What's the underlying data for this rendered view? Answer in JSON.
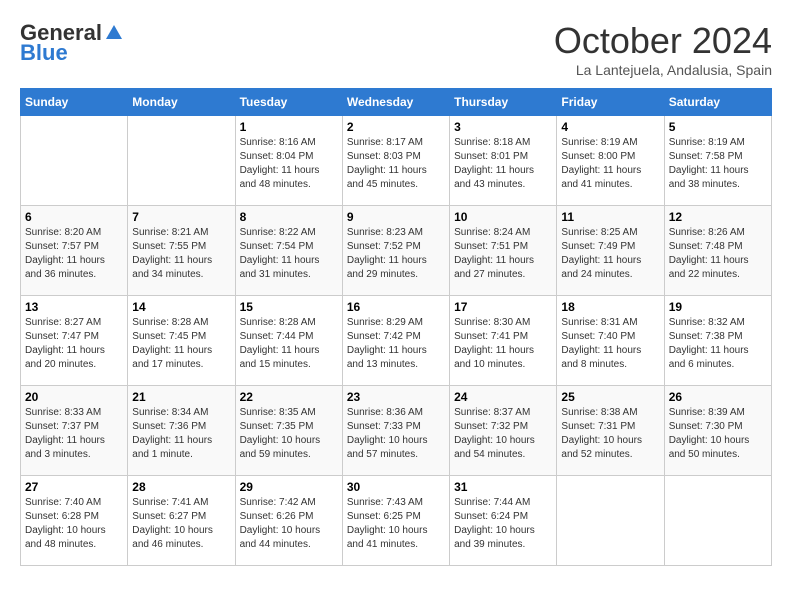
{
  "header": {
    "logo_general": "General",
    "logo_blue": "Blue",
    "month_title": "October 2024",
    "location": "La Lantejuela, Andalusia, Spain"
  },
  "weekdays": [
    "Sunday",
    "Monday",
    "Tuesday",
    "Wednesday",
    "Thursday",
    "Friday",
    "Saturday"
  ],
  "weeks": [
    [
      {
        "day": "",
        "info": ""
      },
      {
        "day": "",
        "info": ""
      },
      {
        "day": "1",
        "info": "Sunrise: 8:16 AM\nSunset: 8:04 PM\nDaylight: 11 hours and 48 minutes."
      },
      {
        "day": "2",
        "info": "Sunrise: 8:17 AM\nSunset: 8:03 PM\nDaylight: 11 hours and 45 minutes."
      },
      {
        "day": "3",
        "info": "Sunrise: 8:18 AM\nSunset: 8:01 PM\nDaylight: 11 hours and 43 minutes."
      },
      {
        "day": "4",
        "info": "Sunrise: 8:19 AM\nSunset: 8:00 PM\nDaylight: 11 hours and 41 minutes."
      },
      {
        "day": "5",
        "info": "Sunrise: 8:19 AM\nSunset: 7:58 PM\nDaylight: 11 hours and 38 minutes."
      }
    ],
    [
      {
        "day": "6",
        "info": "Sunrise: 8:20 AM\nSunset: 7:57 PM\nDaylight: 11 hours and 36 minutes."
      },
      {
        "day": "7",
        "info": "Sunrise: 8:21 AM\nSunset: 7:55 PM\nDaylight: 11 hours and 34 minutes."
      },
      {
        "day": "8",
        "info": "Sunrise: 8:22 AM\nSunset: 7:54 PM\nDaylight: 11 hours and 31 minutes."
      },
      {
        "day": "9",
        "info": "Sunrise: 8:23 AM\nSunset: 7:52 PM\nDaylight: 11 hours and 29 minutes."
      },
      {
        "day": "10",
        "info": "Sunrise: 8:24 AM\nSunset: 7:51 PM\nDaylight: 11 hours and 27 minutes."
      },
      {
        "day": "11",
        "info": "Sunrise: 8:25 AM\nSunset: 7:49 PM\nDaylight: 11 hours and 24 minutes."
      },
      {
        "day": "12",
        "info": "Sunrise: 8:26 AM\nSunset: 7:48 PM\nDaylight: 11 hours and 22 minutes."
      }
    ],
    [
      {
        "day": "13",
        "info": "Sunrise: 8:27 AM\nSunset: 7:47 PM\nDaylight: 11 hours and 20 minutes."
      },
      {
        "day": "14",
        "info": "Sunrise: 8:28 AM\nSunset: 7:45 PM\nDaylight: 11 hours and 17 minutes."
      },
      {
        "day": "15",
        "info": "Sunrise: 8:28 AM\nSunset: 7:44 PM\nDaylight: 11 hours and 15 minutes."
      },
      {
        "day": "16",
        "info": "Sunrise: 8:29 AM\nSunset: 7:42 PM\nDaylight: 11 hours and 13 minutes."
      },
      {
        "day": "17",
        "info": "Sunrise: 8:30 AM\nSunset: 7:41 PM\nDaylight: 11 hours and 10 minutes."
      },
      {
        "day": "18",
        "info": "Sunrise: 8:31 AM\nSunset: 7:40 PM\nDaylight: 11 hours and 8 minutes."
      },
      {
        "day": "19",
        "info": "Sunrise: 8:32 AM\nSunset: 7:38 PM\nDaylight: 11 hours and 6 minutes."
      }
    ],
    [
      {
        "day": "20",
        "info": "Sunrise: 8:33 AM\nSunset: 7:37 PM\nDaylight: 11 hours and 3 minutes."
      },
      {
        "day": "21",
        "info": "Sunrise: 8:34 AM\nSunset: 7:36 PM\nDaylight: 11 hours and 1 minute."
      },
      {
        "day": "22",
        "info": "Sunrise: 8:35 AM\nSunset: 7:35 PM\nDaylight: 10 hours and 59 minutes."
      },
      {
        "day": "23",
        "info": "Sunrise: 8:36 AM\nSunset: 7:33 PM\nDaylight: 10 hours and 57 minutes."
      },
      {
        "day": "24",
        "info": "Sunrise: 8:37 AM\nSunset: 7:32 PM\nDaylight: 10 hours and 54 minutes."
      },
      {
        "day": "25",
        "info": "Sunrise: 8:38 AM\nSunset: 7:31 PM\nDaylight: 10 hours and 52 minutes."
      },
      {
        "day": "26",
        "info": "Sunrise: 8:39 AM\nSunset: 7:30 PM\nDaylight: 10 hours and 50 minutes."
      }
    ],
    [
      {
        "day": "27",
        "info": "Sunrise: 7:40 AM\nSunset: 6:28 PM\nDaylight: 10 hours and 48 minutes."
      },
      {
        "day": "28",
        "info": "Sunrise: 7:41 AM\nSunset: 6:27 PM\nDaylight: 10 hours and 46 minutes."
      },
      {
        "day": "29",
        "info": "Sunrise: 7:42 AM\nSunset: 6:26 PM\nDaylight: 10 hours and 44 minutes."
      },
      {
        "day": "30",
        "info": "Sunrise: 7:43 AM\nSunset: 6:25 PM\nDaylight: 10 hours and 41 minutes."
      },
      {
        "day": "31",
        "info": "Sunrise: 7:44 AM\nSunset: 6:24 PM\nDaylight: 10 hours and 39 minutes."
      },
      {
        "day": "",
        "info": ""
      },
      {
        "day": "",
        "info": ""
      }
    ]
  ]
}
